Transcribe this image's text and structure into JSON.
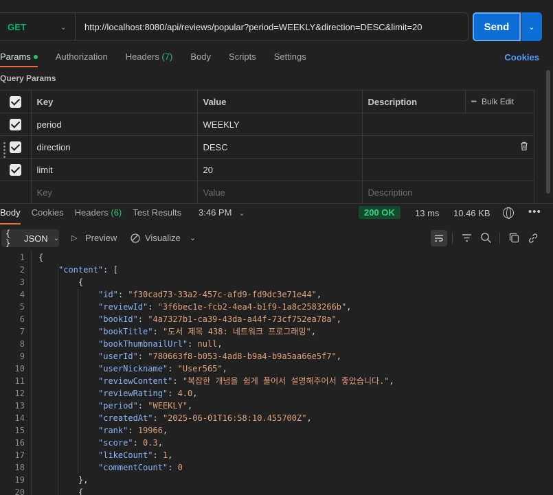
{
  "request": {
    "method": "GET",
    "url": "http://localhost:8080/api/reviews/popular?period=WEEKLY&direction=DESC&limit=20",
    "send_label": "Send"
  },
  "req_tabs": {
    "params": "Params",
    "authorization": "Authorization",
    "headers": "Headers",
    "headers_count": "(7)",
    "body": "Body",
    "scripts": "Scripts",
    "settings": "Settings",
    "cookies": "Cookies"
  },
  "query_params": {
    "section_label": "Query Params",
    "headers": {
      "key": "Key",
      "value": "Value",
      "description": "Description",
      "bulk_edit": "Bulk Edit"
    },
    "rows": [
      {
        "key": "period",
        "value": "WEEKLY",
        "description": ""
      },
      {
        "key": "direction",
        "value": "DESC",
        "description": ""
      },
      {
        "key": "limit",
        "value": "20",
        "description": ""
      }
    ],
    "placeholders": {
      "key": "Key",
      "value": "Value",
      "description": "Description"
    }
  },
  "response": {
    "tabs": {
      "body": "Body",
      "cookies": "Cookies",
      "headers": "Headers",
      "headers_count": "(6)",
      "test_results": "Test Results"
    },
    "time": "3:46 PM",
    "status": "200 OK",
    "duration": "13 ms",
    "size": "10.46 KB",
    "more": "•••"
  },
  "toolbar": {
    "format": "JSON",
    "preview": "Preview",
    "visualize": "Visualize"
  },
  "code_lines": [
    [
      {
        "t": "p",
        "v": "{"
      }
    ],
    [
      {
        "t": "k",
        "v": "\"content\""
      },
      {
        "t": "p",
        "v": ": ["
      }
    ],
    [
      {
        "t": "p",
        "v": "{"
      }
    ],
    [
      {
        "t": "k",
        "v": "\"id\""
      },
      {
        "t": "p",
        "v": ": "
      },
      {
        "t": "s",
        "v": "\"f30cad73-33a2-457c-afd9-fd9dc3e71e44\""
      },
      {
        "t": "p",
        "v": ","
      }
    ],
    [
      {
        "t": "k",
        "v": "\"reviewId\""
      },
      {
        "t": "p",
        "v": ": "
      },
      {
        "t": "s",
        "v": "\"3f6bec1e-fcb2-4ea4-b1f9-1a8c2583266b\""
      },
      {
        "t": "p",
        "v": ","
      }
    ],
    [
      {
        "t": "k",
        "v": "\"bookId\""
      },
      {
        "t": "p",
        "v": ": "
      },
      {
        "t": "s",
        "v": "\"4a7327b1-ca39-43da-a44f-73cf752ea78a\""
      },
      {
        "t": "p",
        "v": ","
      }
    ],
    [
      {
        "t": "k",
        "v": "\"bookTitle\""
      },
      {
        "t": "p",
        "v": ": "
      },
      {
        "t": "s",
        "v": "\"도서 제목 438: 네트워크 프로그래밍\""
      },
      {
        "t": "p",
        "v": ","
      }
    ],
    [
      {
        "t": "k",
        "v": "\"bookThumbnailUrl\""
      },
      {
        "t": "p",
        "v": ": "
      },
      {
        "t": "s",
        "v": "null"
      },
      {
        "t": "p",
        "v": ","
      }
    ],
    [
      {
        "t": "k",
        "v": "\"userId\""
      },
      {
        "t": "p",
        "v": ": "
      },
      {
        "t": "s",
        "v": "\"780663f8-b053-4ad8-b9a4-b9a5aa66e5f7\""
      },
      {
        "t": "p",
        "v": ","
      }
    ],
    [
      {
        "t": "k",
        "v": "\"userNickname\""
      },
      {
        "t": "p",
        "v": ": "
      },
      {
        "t": "s",
        "v": "\"User565\""
      },
      {
        "t": "p",
        "v": ","
      }
    ],
    [
      {
        "t": "k",
        "v": "\"reviewContent\""
      },
      {
        "t": "p",
        "v": ": "
      },
      {
        "t": "s",
        "v": "\"복잡한 개념을 쉽게 풀어서 설명해주어서 좋았습니다.\""
      },
      {
        "t": "p",
        "v": ","
      }
    ],
    [
      {
        "t": "k",
        "v": "\"reviewRating\""
      },
      {
        "t": "p",
        "v": ": "
      },
      {
        "t": "s",
        "v": "4.0"
      },
      {
        "t": "p",
        "v": ","
      }
    ],
    [
      {
        "t": "k",
        "v": "\"period\""
      },
      {
        "t": "p",
        "v": ": "
      },
      {
        "t": "s",
        "v": "\"WEEKLY\""
      },
      {
        "t": "p",
        "v": ","
      }
    ],
    [
      {
        "t": "k",
        "v": "\"createdAt\""
      },
      {
        "t": "p",
        "v": ": "
      },
      {
        "t": "s",
        "v": "\"2025-06-01T16:58:10.455700Z\""
      },
      {
        "t": "p",
        "v": ","
      }
    ],
    [
      {
        "t": "k",
        "v": "\"rank\""
      },
      {
        "t": "p",
        "v": ": "
      },
      {
        "t": "s",
        "v": "19966"
      },
      {
        "t": "p",
        "v": ","
      }
    ],
    [
      {
        "t": "k",
        "v": "\"score\""
      },
      {
        "t": "p",
        "v": ": "
      },
      {
        "t": "s",
        "v": "0.3"
      },
      {
        "t": "p",
        "v": ","
      }
    ],
    [
      {
        "t": "k",
        "v": "\"likeCount\""
      },
      {
        "t": "p",
        "v": ": "
      },
      {
        "t": "s",
        "v": "1"
      },
      {
        "t": "p",
        "v": ","
      }
    ],
    [
      {
        "t": "k",
        "v": "\"commentCount\""
      },
      {
        "t": "p",
        "v": ": "
      },
      {
        "t": "s",
        "v": "0"
      }
    ],
    [
      {
        "t": "p",
        "v": "},"
      }
    ],
    [
      {
        "t": "p",
        "v": "{"
      }
    ]
  ],
  "code_indents": [
    0,
    1,
    2,
    3,
    3,
    3,
    3,
    3,
    3,
    3,
    3,
    3,
    3,
    3,
    3,
    3,
    3,
    3,
    2,
    2
  ],
  "colors": {
    "accent": "#0c6fd8",
    "method_get": "#00b66c",
    "status_ok": "#35d07f",
    "tab_underline": "#f26b3a",
    "json_key": "#8ab4f8",
    "json_value": "#e0a07b"
  }
}
